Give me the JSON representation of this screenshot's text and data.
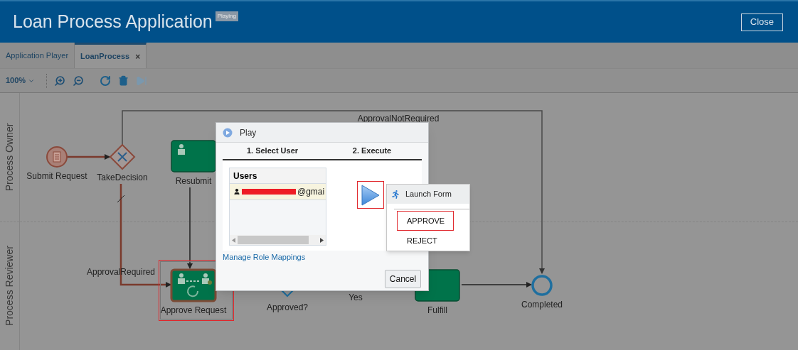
{
  "header": {
    "title": "Loan Process Application",
    "badge": "Playing",
    "close_button": "Close"
  },
  "tabs": [
    {
      "label": "Application Player",
      "selected": false
    },
    {
      "label": "LoanProcess",
      "selected": true,
      "close": "×"
    }
  ],
  "toolbar": {
    "zoom": "100%",
    "step_disabled": true
  },
  "lanes": [
    "Process Owner",
    "Process Reviewer"
  ],
  "nodes": [
    {
      "kind": "start",
      "label": "Submit Request",
      "selected": false
    },
    {
      "kind": "gateway",
      "label": "TakeDecision",
      "selected": false
    },
    {
      "kind": "task",
      "label": "Resubmit",
      "selected": false
    },
    {
      "kind": "approval",
      "label": "Approve Request",
      "selected": true
    },
    {
      "kind": "decision",
      "label": "Approved?",
      "selected": false
    },
    {
      "kind": "task",
      "label": "Fulfill",
      "selected": false
    },
    {
      "kind": "end",
      "label": "Completed",
      "selected": false
    }
  ],
  "flow_labels": [
    "ApprovalNotRequired",
    "ApprovalRequired",
    "Yes"
  ],
  "dialog": {
    "title": "Play",
    "steps": [
      "1. Select User",
      "2. Execute"
    ],
    "users_header": "Users",
    "users": [
      {
        "name": "@gmai",
        "selected": true
      }
    ],
    "link": "Manage Role Mappings",
    "cancel": "Cancel",
    "menu": {
      "title": "Launch Form",
      "items": [
        {
          "label": "APPROVE",
          "selected": true
        },
        {
          "label": "REJECT",
          "selected": false
        }
      ]
    }
  }
}
